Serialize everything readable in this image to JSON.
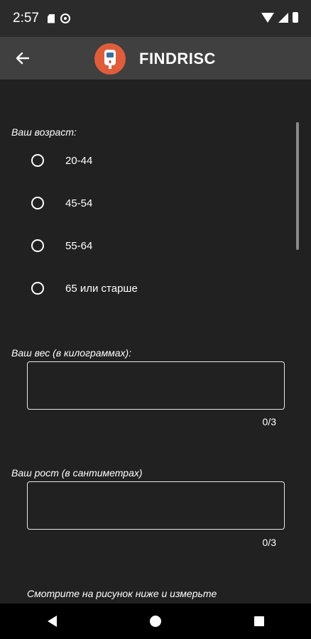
{
  "status": {
    "time": "2:57"
  },
  "appbar": {
    "title": "FINDRISC"
  },
  "colors": {
    "background": "#212121",
    "appbar": "#404040",
    "logo_accent": "#e05d3c"
  },
  "icons": [
    "arrow-left-icon",
    "glucometer-icon",
    "sd-card-icon",
    "cast-icon",
    "wifi-icon",
    "signal-icon",
    "battery-icon"
  ],
  "age": {
    "label": "Ваш возраст:",
    "options": [
      "20-44",
      "45-54",
      "55-64",
      "65 или старше"
    ]
  },
  "weight": {
    "label": "Ваш вес (в килограммах):",
    "value": "",
    "counter": "0/3"
  },
  "height": {
    "label": "Ваш рост (в сантиметрах)",
    "value": "",
    "counter": "0/3"
  },
  "hint": {
    "text": "Смотрите на рисунок ниже и измерьте"
  }
}
